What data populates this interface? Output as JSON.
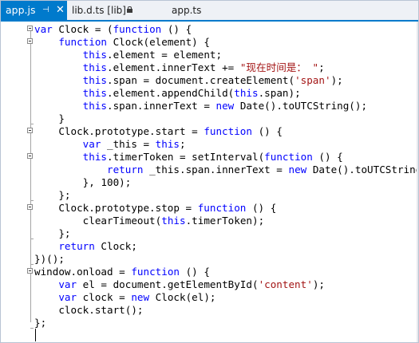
{
  "tabs": [
    {
      "label": "app.js",
      "active": true,
      "pin_glyph": "⊣",
      "close_glyph": "✕"
    },
    {
      "label": "lib.d.ts [lib]",
      "active": false,
      "locked": true
    },
    {
      "label": "app.ts",
      "active": false
    }
  ],
  "icons": [
    "pin-icon",
    "close-icon",
    "lock-icon",
    "fold-toggle-icon"
  ],
  "colors": {
    "accent": "#007acc",
    "keyword": "#0000ff",
    "string": "#a31515",
    "text": "#000000"
  },
  "code": [
    [
      {
        "t": "var",
        "c": "kw"
      },
      {
        "t": " Clock = ("
      },
      {
        "t": "function",
        "c": "kw"
      },
      {
        "t": " () {"
      }
    ],
    [
      {
        "t": "    "
      },
      {
        "t": "function",
        "c": "kw"
      },
      {
        "t": " Clock(element) {"
      }
    ],
    [
      {
        "t": "        "
      },
      {
        "t": "this",
        "c": "kw"
      },
      {
        "t": ".element = element;"
      }
    ],
    [
      {
        "t": "        "
      },
      {
        "t": "this",
        "c": "kw"
      },
      {
        "t": ".element.innerText += "
      },
      {
        "t": "\"现在时间是： \"",
        "c": "str"
      },
      {
        "t": ";"
      }
    ],
    [
      {
        "t": "        "
      },
      {
        "t": "this",
        "c": "kw"
      },
      {
        "t": ".span = document.createElement("
      },
      {
        "t": "'span'",
        "c": "str"
      },
      {
        "t": ");"
      }
    ],
    [
      {
        "t": "        "
      },
      {
        "t": "this",
        "c": "kw"
      },
      {
        "t": ".element.appendChild("
      },
      {
        "t": "this",
        "c": "kw"
      },
      {
        "t": ".span);"
      }
    ],
    [
      {
        "t": "        "
      },
      {
        "t": "this",
        "c": "kw"
      },
      {
        "t": ".span.innerText = "
      },
      {
        "t": "new",
        "c": "kw"
      },
      {
        "t": " Date().toUTCString();"
      }
    ],
    [
      {
        "t": "    }"
      }
    ],
    [
      {
        "t": "    Clock.prototype.start = "
      },
      {
        "t": "function",
        "c": "kw"
      },
      {
        "t": " () {"
      }
    ],
    [
      {
        "t": "        "
      },
      {
        "t": "var",
        "c": "kw"
      },
      {
        "t": " _this = "
      },
      {
        "t": "this",
        "c": "kw"
      },
      {
        "t": ";"
      }
    ],
    [
      {
        "t": "        "
      },
      {
        "t": "this",
        "c": "kw"
      },
      {
        "t": ".timerToken = setInterval("
      },
      {
        "t": "function",
        "c": "kw"
      },
      {
        "t": " () {"
      }
    ],
    [
      {
        "t": "            "
      },
      {
        "t": "return",
        "c": "kw"
      },
      {
        "t": " _this.span.innerText = "
      },
      {
        "t": "new",
        "c": "kw"
      },
      {
        "t": " Date().toUTCString();"
      }
    ],
    [
      {
        "t": "        }, 100);"
      }
    ],
    [
      {
        "t": "    };"
      }
    ],
    [
      {
        "t": "    Clock.prototype.stop = "
      },
      {
        "t": "function",
        "c": "kw"
      },
      {
        "t": " () {"
      }
    ],
    [
      {
        "t": "        clearTimeout("
      },
      {
        "t": "this",
        "c": "kw"
      },
      {
        "t": ".timerToken);"
      }
    ],
    [
      {
        "t": "    };"
      }
    ],
    [
      {
        "t": "    "
      },
      {
        "t": "return",
        "c": "kw"
      },
      {
        "t": " Clock;"
      }
    ],
    [
      {
        "t": "})();"
      }
    ],
    [
      {
        "t": "window.onload = "
      },
      {
        "t": "function",
        "c": "kw"
      },
      {
        "t": " () {"
      }
    ],
    [
      {
        "t": "    "
      },
      {
        "t": "var",
        "c": "kw"
      },
      {
        "t": " el = document.getElementById("
      },
      {
        "t": "'content'",
        "c": "str"
      },
      {
        "t": ");"
      }
    ],
    [
      {
        "t": "    "
      },
      {
        "t": "var",
        "c": "kw"
      },
      {
        "t": " clock = "
      },
      {
        "t": "new",
        "c": "kw"
      },
      {
        "t": " Clock(el);"
      }
    ],
    [
      {
        "t": "    clock.start();"
      }
    ],
    [
      {
        "t": "};"
      }
    ],
    [
      {
        "t": ""
      }
    ]
  ]
}
